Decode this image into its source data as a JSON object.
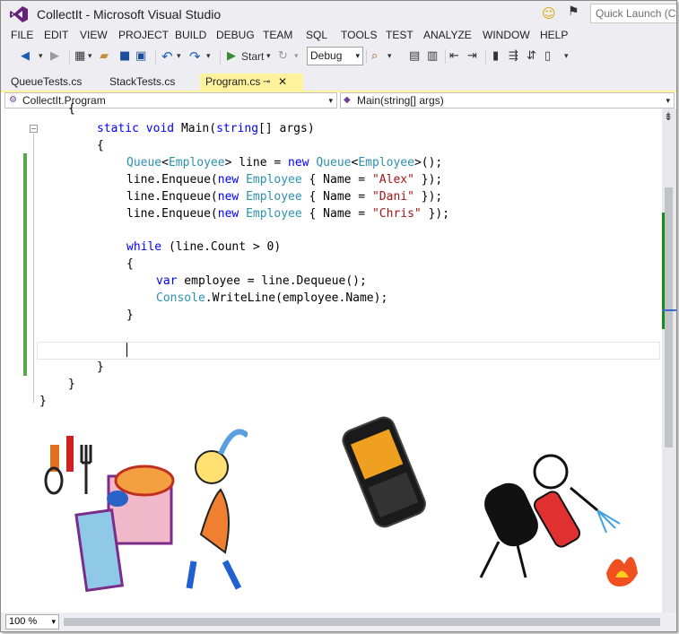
{
  "window": {
    "title": "CollectIt - Microsoft Visual Studio",
    "quick_launch_placeholder": "Quick Launch (Ctrl"
  },
  "menu": [
    "FILE",
    "EDIT",
    "VIEW",
    "PROJECT",
    "BUILD",
    "DEBUG",
    "TEAM",
    "SQL",
    "TOOLS",
    "TEST",
    "ANALYZE",
    "WINDOW",
    "HELP"
  ],
  "toolbar": {
    "start_label": "Start",
    "config": "Debug"
  },
  "tabs": [
    "QueueTests.cs",
    "StackTests.cs",
    "Program.cs"
  ],
  "navbar": {
    "type_selector": "CollectIt.Program",
    "member_selector": "Main(string[] args)"
  },
  "code": {
    "l1": "{",
    "l2_a": "static",
    "l2_b": "void",
    "l2_c": "Main(",
    "l2_d": "string",
    "l2_e": "[] args)",
    "l3": "{",
    "l4_a": "Queue",
    "l4_b": "<",
    "l4_c": "Employee",
    "l4_d": "> line = ",
    "l4_e": "new",
    "l4_f": " ",
    "l4_g": "Queue",
    "l4_h": "<",
    "l4_i": "Employee",
    "l4_j": ">();",
    "l5_a": "line.Enqueue(",
    "l5_b": "new",
    "l5_c": " ",
    "l5_d": "Employee",
    "l5_e": " { Name = ",
    "l5_f": "\"Alex\"",
    "l5_g": " });",
    "l6_a": "line.Enqueue(",
    "l6_b": "new",
    "l6_c": " ",
    "l6_d": "Employee",
    "l6_e": " { Name = ",
    "l6_f": "\"Dani\"",
    "l6_g": " });",
    "l7_a": "line.Enqueue(",
    "l7_b": "new",
    "l7_c": " ",
    "l7_d": "Employee",
    "l7_e": " { Name = ",
    "l7_f": "\"Chris\"",
    "l7_g": " });",
    "l8_a": "while",
    "l8_b": " (line.Count > 0)",
    "l9": "{",
    "l10_a": "var",
    "l10_b": " employee = line.Dequeue();",
    "l11_a": "Console",
    "l11_b": ".WriteLine(employee.Name);",
    "l12": "}",
    "l13": "}",
    "l14": "}",
    "l15": "}"
  },
  "statusbar": {
    "zoom": "100 %"
  },
  "colors": {
    "keyword": "#0000ff",
    "type": "#2b91af",
    "string": "#a31515",
    "active_tab": "#fff29d",
    "change_bar": "#57a64a"
  }
}
